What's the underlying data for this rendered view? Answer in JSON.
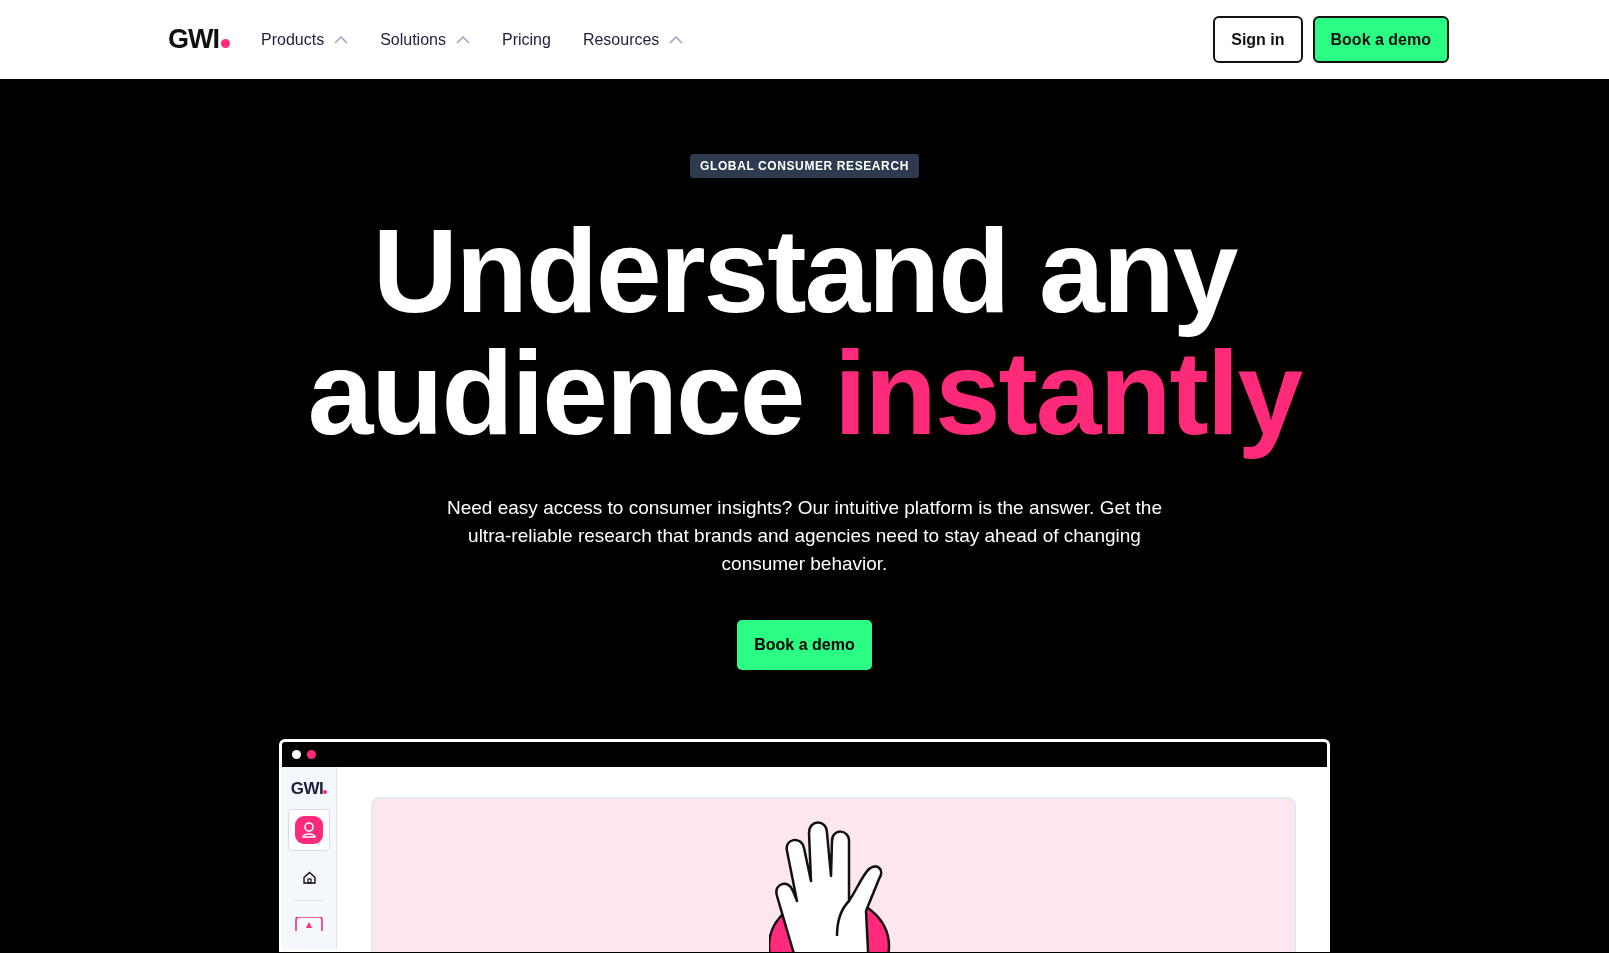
{
  "header": {
    "logo": "GWI",
    "nav": [
      {
        "label": "Products",
        "dropdown": true
      },
      {
        "label": "Solutions",
        "dropdown": true
      },
      {
        "label": "Pricing",
        "dropdown": false
      },
      {
        "label": "Resources",
        "dropdown": true
      }
    ],
    "sign_in": "Sign in",
    "book_demo": "Book a demo"
  },
  "hero": {
    "badge": "GLOBAL CONSUMER RESEARCH",
    "title": "Understand any audience",
    "title_highlight": "instantly",
    "description": "Need easy access to consumer insights? Our intuitive platform is the answer. Get the ultra-reliable research that brands and agencies need to stay ahead of changing consumer behavior.",
    "cta": "Book a demo"
  },
  "mockup": {
    "logo": "GWI"
  }
}
